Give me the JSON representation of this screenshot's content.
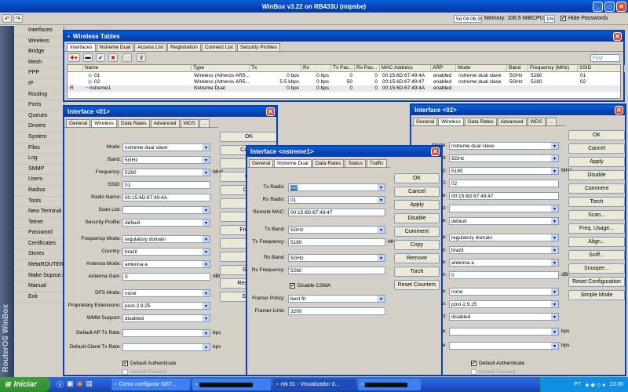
{
  "title": "WinBox v3.22 on RB433U (mipsbe)",
  "status": {
    "uptime": "5d 04:06:39",
    "memory": "Memory: 106.5 MiB",
    "cpu": "CPU:",
    "cpu_val": "1%",
    "hide_pw": "Hide Passwords"
  },
  "vertical": "RouterOS WinBox",
  "menu": [
    "Interfaces",
    "Wireless",
    "Bridge",
    "Mesh",
    "PPP",
    "IP",
    "Routing",
    "Ports",
    "Queues",
    "Drivers",
    "System",
    "Files",
    "Log",
    "SNMP",
    "Users",
    "Radius",
    "Tools",
    "New Terminal",
    "Telnet",
    "Password",
    "Certificates",
    "Stores",
    "MetaROUTER",
    "Make Supout.rif",
    "Manual",
    "Exit"
  ],
  "wt": {
    "title": "Wireless Tables",
    "tabs": [
      "Interfaces",
      "Nstreme Dual",
      "Access List",
      "Registration",
      "Connect List",
      "Security Profiles"
    ],
    "find": "Find",
    "cols": [
      "",
      "Name",
      "Type",
      "Tx",
      "Rx",
      "Tx Pac...",
      "Rx Pac...",
      "MAC Address",
      "ARP",
      "Mode",
      "Band",
      "Frequency (MHz)",
      "SSID"
    ],
    "rows": [
      [
        "",
        "01",
        "Wireless (Atheros AR5...",
        "0 bps",
        "0 bps",
        "0",
        "0",
        "00:15:6D:67:49:4A",
        "enabled",
        "nstreme dual slave",
        "5GHz",
        "5280",
        "01"
      ],
      [
        "",
        "02",
        "Wireless (Atheros AR5...",
        "5.5 kbps",
        "0 bps",
        "50",
        "0",
        "00:15:6D:67:49:47",
        "enabled",
        "nstreme dual slave",
        "5GHz",
        "5180",
        "02"
      ],
      [
        "R",
        "nstreme1",
        "Nstreme Dual",
        "0 bps",
        "0 bps",
        "0",
        "0",
        "00:15:6D:67:49:4A",
        "enabled",
        "",
        "",
        "",
        ""
      ]
    ]
  },
  "w1": {
    "title": "Interface <01>",
    "tabs": [
      "General",
      "Wireless",
      "Data Rates",
      "Advanced",
      "WDS",
      "..."
    ],
    "fields": [
      {
        "label": "Mode:",
        "value": "nstreme dual slave",
        "dd": true
      },
      {
        "label": "Band:",
        "value": "5GHz",
        "dd": true
      },
      {
        "label": "Frequency:",
        "value": "5280",
        "dd": true,
        "unit": "MHz"
      },
      {
        "label": "SSID:",
        "value": "01"
      },
      {
        "label": "Radio Name:",
        "value": "00:15:6D:67:49:4A"
      },
      {
        "label": "Scan List:",
        "value": "",
        "dd": true
      },
      {
        "label": "Security Profile:",
        "value": "default",
        "dd": true
      },
      {
        "label": "Frequency Mode:",
        "value": "regulatory domain",
        "dd": true
      },
      {
        "label": "Country:",
        "value": "brazil",
        "dd": true
      },
      {
        "label": "Antenna Mode:",
        "value": "antenna a",
        "dd": true
      },
      {
        "label": "Antenna Gain:",
        "value": "0",
        "unit": "dBi"
      },
      {
        "label": "DFS Mode:",
        "value": "none",
        "dd": true
      },
      {
        "label": "Proprietary Extensions:",
        "value": "post-2.9.25",
        "dd": true
      },
      {
        "label": "WMM Support:",
        "value": "disabled",
        "dd": true
      },
      {
        "label": "Default AP Tx Rate:",
        "value": "",
        "dd": true,
        "unit": "bps"
      },
      {
        "label": "Default Client Tx Rate:",
        "value": "",
        "dd": true,
        "unit": "bps"
      }
    ],
    "checks": [
      "Default Authenticate",
      "Default Forward",
      "Hide SSID"
    ],
    "buttons": [
      "OK",
      "Cancel",
      "A",
      "Dis",
      "Com",
      "To",
      "Sc",
      "Freq. U",
      "Al",
      "Sn",
      "Snoo",
      "Reset Co",
      "Simpl"
    ]
  },
  "w2": {
    "title": "Interface <02>",
    "tabs": [
      "General",
      "Wireless",
      "Data Rates",
      "Advanced",
      "WDS",
      "..."
    ],
    "fields": [
      {
        "label": "Mode:",
        "value": "nstreme dual slave",
        "dd": true
      },
      {
        "label": "Band:",
        "value": "5GHz",
        "dd": true
      },
      {
        "label": "Frequency:",
        "value": "5180",
        "dd": true,
        "unit": "MHz"
      },
      {
        "label": "SSID:",
        "value": "02"
      },
      {
        "label": "Radio Name:",
        "value": "00:15:6D:67:49:47"
      },
      {
        "label": "Scan List:",
        "value": "",
        "dd": true
      },
      {
        "label": "Security Profile:",
        "value": "default",
        "dd": true
      },
      {
        "label": "Frequency Mode:",
        "value": "regulatory domain",
        "dd": true
      },
      {
        "label": "Country:",
        "value": "brazil",
        "dd": true
      },
      {
        "label": "Antenna Mode:",
        "value": "antenna a",
        "dd": true
      },
      {
        "label": "Antenna Gain:",
        "value": "0",
        "unit": "dBi"
      },
      {
        "label": "DFS Mode:",
        "value": "none",
        "dd": true
      },
      {
        "label": "Proprietary Extensions:",
        "value": "post-2.9.25",
        "dd": true
      },
      {
        "label": "WMM Support:",
        "value": "disabled",
        "dd": true
      },
      {
        "label": "AP Tx Rate:",
        "value": "",
        "dd": true,
        "unit": "bps"
      },
      {
        "label": "Client Tx Rate:",
        "value": "",
        "dd": true,
        "unit": "bps"
      }
    ],
    "checks": [
      "Default Authenticate",
      "Default Forward",
      "Hide SSID"
    ],
    "buttons": [
      "OK",
      "Cancel",
      "Apply",
      "Disable",
      "Comment",
      "Torch",
      "Scan...",
      "Freq. Usage...",
      "Align...",
      "Sniff...",
      "Snooper...",
      "Reset Configuration",
      "Simple Mode"
    ]
  },
  "ns": {
    "title": "Interface <nstreme1>",
    "tabs": [
      "General",
      "Nstreme Dual",
      "Data Rates",
      "Status",
      "Traffic"
    ],
    "fields": [
      {
        "label": "Tx Radio:",
        "value": "02",
        "dd": true,
        "sel": true
      },
      {
        "label": "Rx Radio:",
        "value": "01",
        "dd": true
      },
      {
        "label": "Remote MAC:",
        "value": "00:15:6D:67:49:47"
      },
      {
        "label": "Tx Band:",
        "value": "5GHz",
        "dd": true
      },
      {
        "label": "Tx Frequency:",
        "value": "5180",
        "unit": "MHz"
      },
      {
        "label": "Rx Band:",
        "value": "5GHz",
        "dd": true
      },
      {
        "label": "Rx Frequency:",
        "value": "5280"
      },
      {
        "label": "Framer Policy:",
        "value": "best fit",
        "dd": true
      },
      {
        "label": "Framer Limit:",
        "value": "3200"
      }
    ],
    "csma": "Disable CSMA",
    "buttons": [
      "OK",
      "Cancel",
      "Apply",
      "Disable",
      "Comment",
      "Copy",
      "Remove",
      "Torch",
      "Reset Counters"
    ]
  },
  "taskbar": {
    "start": "Iniciar",
    "tasks": [
      "Como configurar NST...",
      "",
      "mk 01 - Visualizador d...",
      ""
    ],
    "lang": "PT",
    "time": "23:36"
  }
}
